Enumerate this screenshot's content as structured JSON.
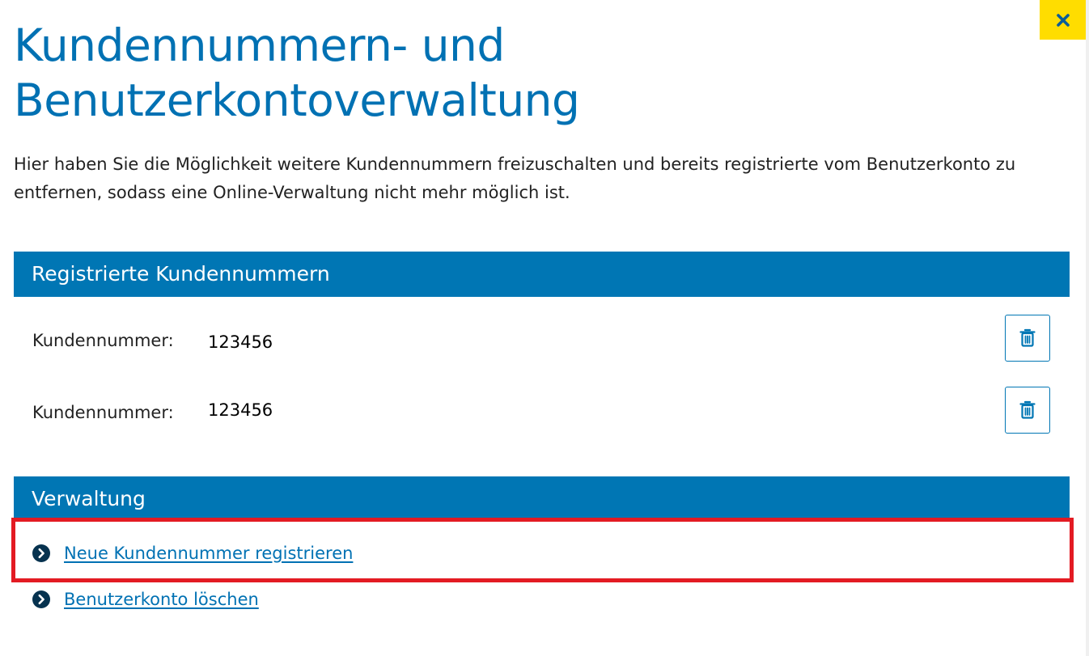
{
  "dialog": {
    "close_icon": "close-x-icon",
    "title": "Kundennummern- und Benutzerkontoverwaltung",
    "intro": "Hier haben Sie die Möglichkeit weitere Kundennummern freizuschalten und bereits registrierte vom Benutzerkonto zu entfernen, sodass eine Online-Verwaltung nicht mehr möglich ist."
  },
  "registered_section": {
    "heading": "Registrierte Kundennummern",
    "items": [
      {
        "label": "Kundennummer:",
        "value": "123456",
        "delete_icon": "trash-icon"
      },
      {
        "label": "Kundennummer:",
        "value": "123456",
        "delete_icon": "trash-icon"
      }
    ]
  },
  "admin_section": {
    "heading": "Verwaltung",
    "links": [
      {
        "label": "Neue Kundennummer registrieren",
        "icon": "chevron-right-circle-icon",
        "highlighted": true
      },
      {
        "label": "Benutzerkonto löschen",
        "icon": "chevron-right-circle-icon"
      }
    ]
  },
  "colors": {
    "accent": "#0076b4",
    "title": "#0071b3",
    "close_button": "#ffdd00",
    "highlight": "#e31b23"
  }
}
